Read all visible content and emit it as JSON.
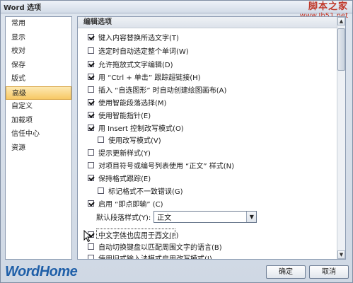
{
  "title_bar": {
    "title": "Word 选项"
  },
  "watermark": {
    "site_name": "脚本之家",
    "site_url": "www.Jb51.net"
  },
  "sidebar": {
    "items": [
      {
        "label": "常用",
        "selected": false
      },
      {
        "label": "显示",
        "selected": false
      },
      {
        "label": "校对",
        "selected": false
      },
      {
        "label": "保存",
        "selected": false
      },
      {
        "label": "版式",
        "selected": false
      },
      {
        "label": "高级",
        "selected": true
      },
      {
        "label": "自定义",
        "selected": false
      },
      {
        "label": "加载项",
        "selected": false
      },
      {
        "label": "信任中心",
        "selected": false
      },
      {
        "label": "资源",
        "selected": false
      }
    ]
  },
  "content": {
    "section_title": "编辑选项",
    "options": [
      {
        "label": "键入内容替换所选文字(T)",
        "checked": true
      },
      {
        "label": "选定时自动选定整个单词(W)",
        "checked": false
      },
      {
        "label": "允许拖放式文字编辑(D)",
        "checked": true
      },
      {
        "label": "用 “Ctrl + 单击” 跟踪超链接(H)",
        "checked": true
      },
      {
        "label": "插入 “自选图形” 时自动创建绘图画布(A)",
        "checked": false
      },
      {
        "label": "使用智能段落选择(M)",
        "checked": true
      },
      {
        "label": "使用智能指针(E)",
        "checked": true
      },
      {
        "label": "用 Insert 控制改写模式(O)",
        "checked": true
      },
      {
        "label": "使用改写模式(V)",
        "checked": false
      },
      {
        "label": "提示更新样式(Y)",
        "checked": false
      },
      {
        "label": "对项目符号或编号列表使用 “正文” 样式(N)",
        "checked": false
      },
      {
        "label": "保持格式跟踪(E)",
        "checked": true
      },
      {
        "label": "标记格式不一致错误(G)",
        "checked": false
      },
      {
        "label": "启用 “即点即输” (C)",
        "checked": true
      },
      {
        "label": "中文字体也应用于西文(F)",
        "checked": true
      },
      {
        "label": "自动切换键盘以匹配周围文字的语言(B)",
        "checked": false
      },
      {
        "label": "使用旧式输入法模式启用改写模式(I)",
        "checked": false
      }
    ],
    "default_paragraph_style": {
      "label": "默认段落样式(Y):",
      "value": "正文"
    }
  },
  "footer": {
    "logo": "WordHome",
    "ok_label": "确定",
    "cancel_label": "取消"
  },
  "icons": {
    "dropdown": "chevron-down-icon",
    "scroll_up": "arrow-up-icon",
    "scroll_down": "arrow-down-icon",
    "cursor": "mouse-pointer-icon"
  },
  "colors": {
    "selected_item": "#f7c865",
    "logo": "#1f5fa8",
    "watermark": "#c0392b"
  }
}
